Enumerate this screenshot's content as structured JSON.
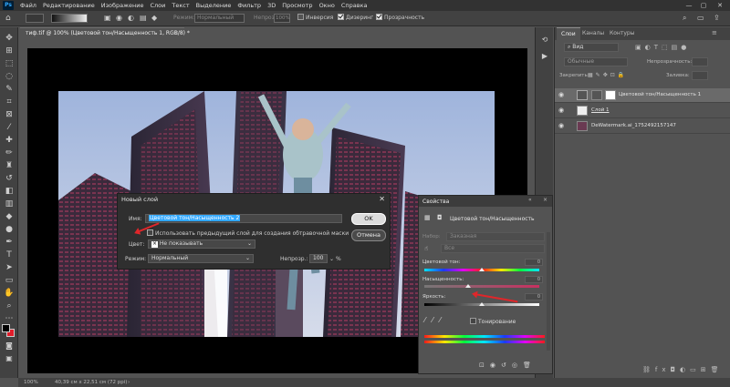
{
  "menu": {
    "logo": "Ps",
    "items": [
      "Файл",
      "Редактирование",
      "Изображение",
      "Слои",
      "Текст",
      "Выделение",
      "Фильтр",
      "3D",
      "Просмотр",
      "Окно",
      "Справка"
    ]
  },
  "options": {
    "mode_label": "Режим:",
    "mode_value": "Нормальный",
    "opacity_label": "Непрозр.:",
    "opacity_value": "100%",
    "inversion_label": "Инверсия",
    "dither_label": "Дизеринг",
    "transparency_label": "Прозрачность"
  },
  "document": {
    "tab_title": "тиф.tif @ 100% (Цветовой тон/Насыщенность 1, RGB/8) *",
    "zoom": "100%",
    "size_info": "40,39 см x 22,51 см (72 ppi)"
  },
  "dialog": {
    "title": "Новый слой",
    "name_label": "Имя:",
    "name_value": "Цветовой тон/Насыщенность 2",
    "clip_label": "Использовать предыдущий слой для создания обтравочной маски",
    "color_label": "Цвет:",
    "color_value": "Не показывать",
    "mode_label": "Режим:",
    "mode_value": "Нормальный",
    "opacity_label": "Непрозр.:",
    "opacity_value": "100",
    "opacity_unit": "%",
    "ok_label": "OK",
    "cancel_label": "Отмена"
  },
  "layers": {
    "tabs": [
      "Слои",
      "Каналы",
      "Контуры"
    ],
    "filter_placeholder": "Вид",
    "blend_mode": "Обычные",
    "opacity_label": "Непрозрачность:",
    "lock_label": "Закрепить:",
    "fill_label": "Заливка:",
    "items": [
      {
        "name": "Цветовой тон/Насыщенность 1"
      },
      {
        "name": "Слой 1"
      },
      {
        "name": "DeWatermark.ai_1752492157147"
      }
    ]
  },
  "properties": {
    "title": "Свойства",
    "adjustment_name": "Цветовой тон/Насыщенность",
    "preset_label": "Набор:",
    "preset_value": "Заказная",
    "channel_value": "Все",
    "hue_label": "Цветовой тон:",
    "hue_value": "0",
    "saturation_label": "Насыщенность:",
    "saturation_value": "0",
    "lightness_label": "Яркость:",
    "lightness_value": "0",
    "colorize_label": "Тонирование"
  },
  "colors": {
    "highlight": "#31a8ff",
    "arrow": "#e0262a",
    "accent_fg": "#000000",
    "accent_bg": "#e11d2a"
  }
}
